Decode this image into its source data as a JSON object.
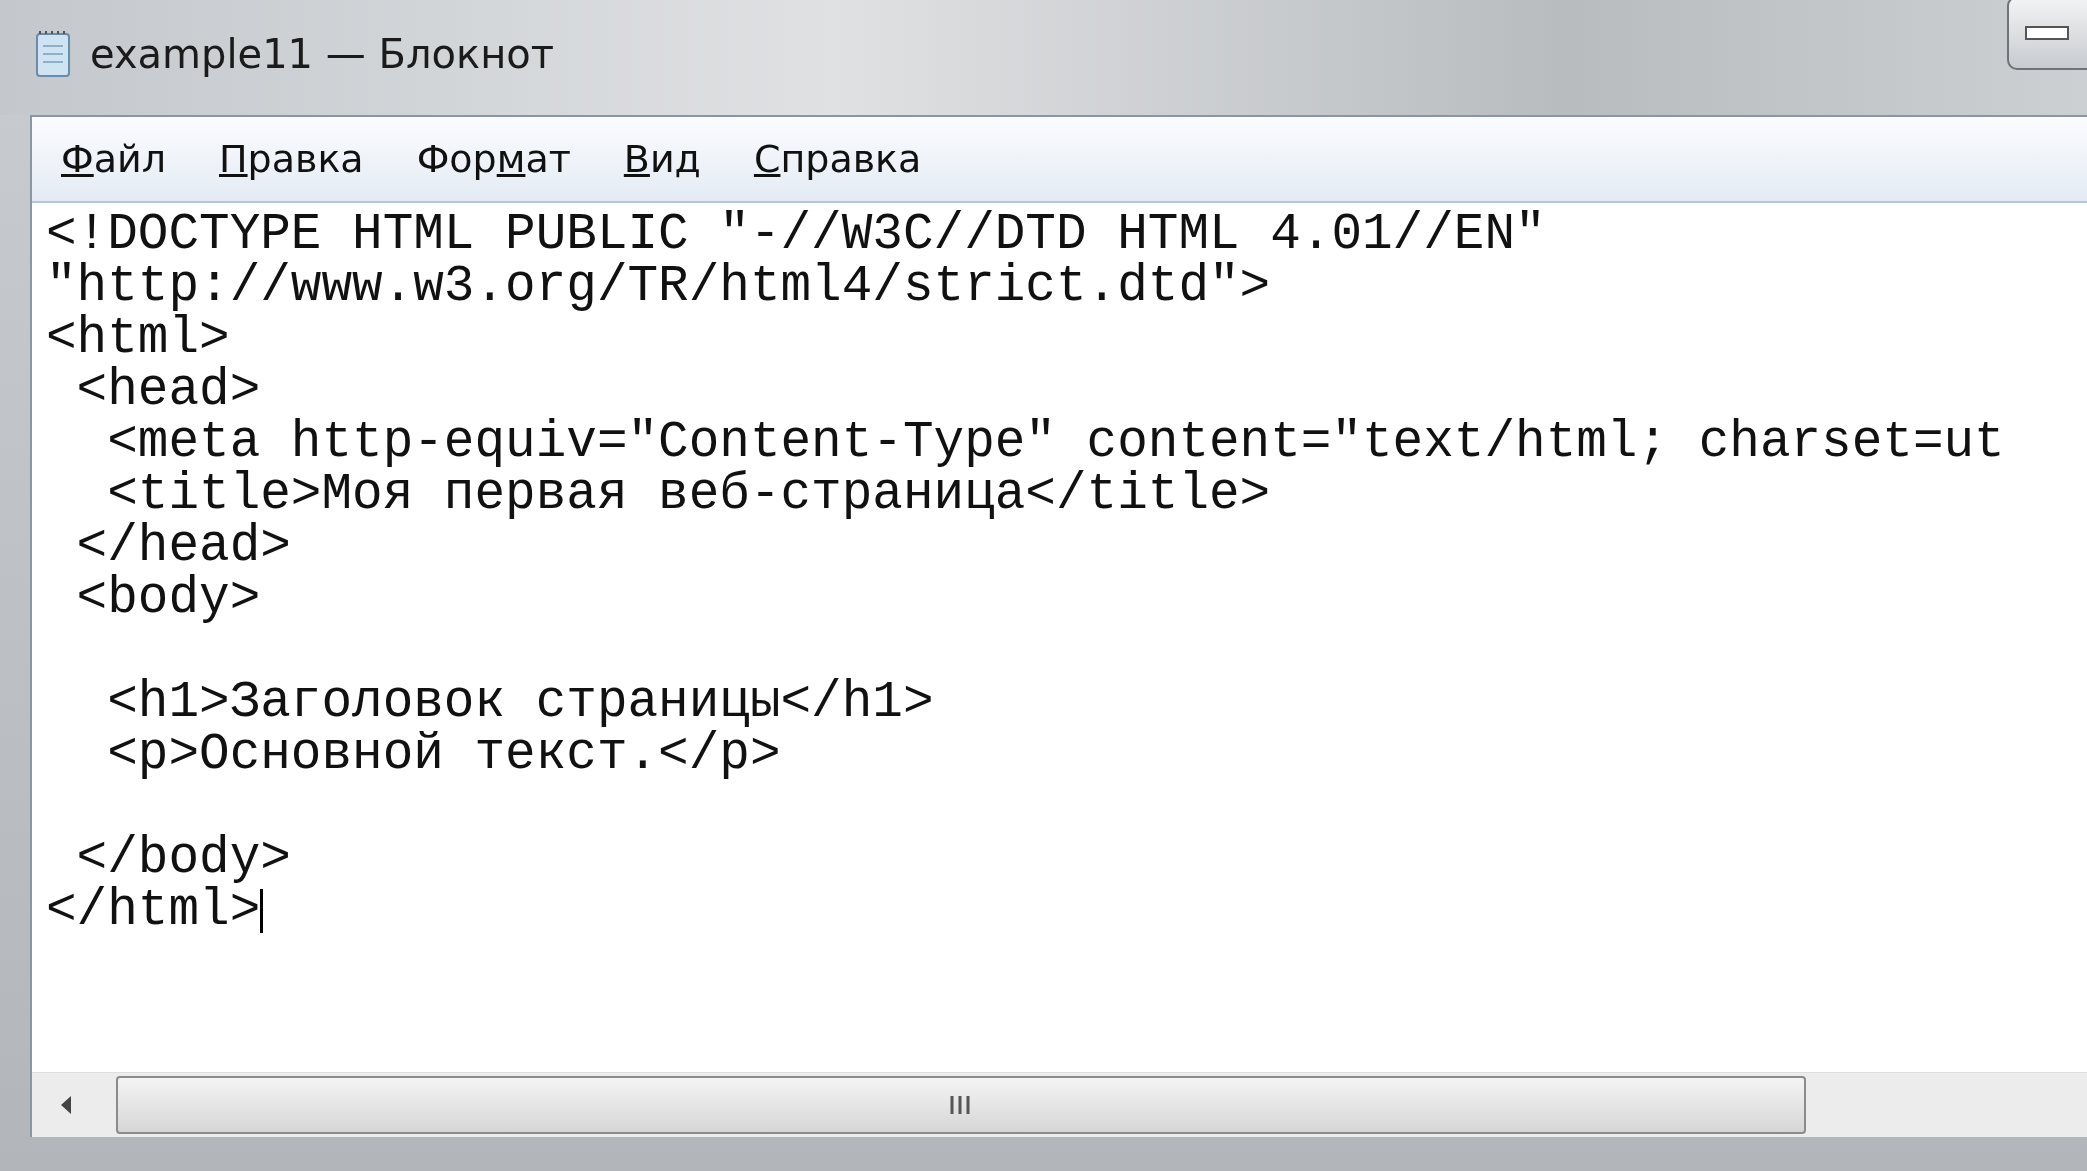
{
  "window": {
    "title": "example11 — Блокнот"
  },
  "menu": [
    {
      "label_parts": [
        {
          "text": "Ф",
          "underlined": true
        },
        {
          "text": "айл",
          "underlined": false
        }
      ]
    },
    {
      "label_parts": [
        {
          "text": "П",
          "underlined": true
        },
        {
          "text": "равка",
          "underlined": false
        }
      ]
    },
    {
      "label_parts": [
        {
          "text": "Фор",
          "underlined": false
        },
        {
          "text": "м",
          "underlined": true
        },
        {
          "text": "ат",
          "underlined": false
        }
      ]
    },
    {
      "label_parts": [
        {
          "text": "В",
          "underlined": true
        },
        {
          "text": "ид",
          "underlined": false
        }
      ]
    },
    {
      "label_parts": [
        {
          "text": "С",
          "underlined": true
        },
        {
          "text": "правка",
          "underlined": false
        }
      ]
    }
  ],
  "editor": {
    "lines": [
      {
        "kind": "code",
        "text": "<!DOCTYPE HTML PUBLIC \"-//W3C//DTD HTML 4.01//EN\"",
        "caret": false
      },
      {
        "kind": "code",
        "text": "\"http://www.w3.org/TR/html4/strict.dtd\">",
        "caret": false
      },
      {
        "kind": "code",
        "text": "<html>",
        "caret": false
      },
      {
        "kind": "code",
        "text": " <head>",
        "caret": false
      },
      {
        "kind": "code",
        "text": "  <meta http-equiv=\"Content-Type\" content=\"text/html; charset=ut",
        "caret": false
      },
      {
        "kind": "code",
        "text": "  <title>Моя первая веб-страница</title>",
        "caret": false
      },
      {
        "kind": "code",
        "text": " </head>",
        "caret": false
      },
      {
        "kind": "code",
        "text": " <body>",
        "caret": false
      },
      {
        "kind": "blank"
      },
      {
        "kind": "code",
        "text": "  <h1>Заголовок страницы</h1>",
        "caret": false
      },
      {
        "kind": "code",
        "text": "  <p>Основной текст.</p>",
        "caret": false
      },
      {
        "kind": "blank"
      },
      {
        "kind": "code",
        "text": " </body>",
        "caret": false
      },
      {
        "kind": "code",
        "text": "</html>",
        "caret": true
      }
    ]
  }
}
